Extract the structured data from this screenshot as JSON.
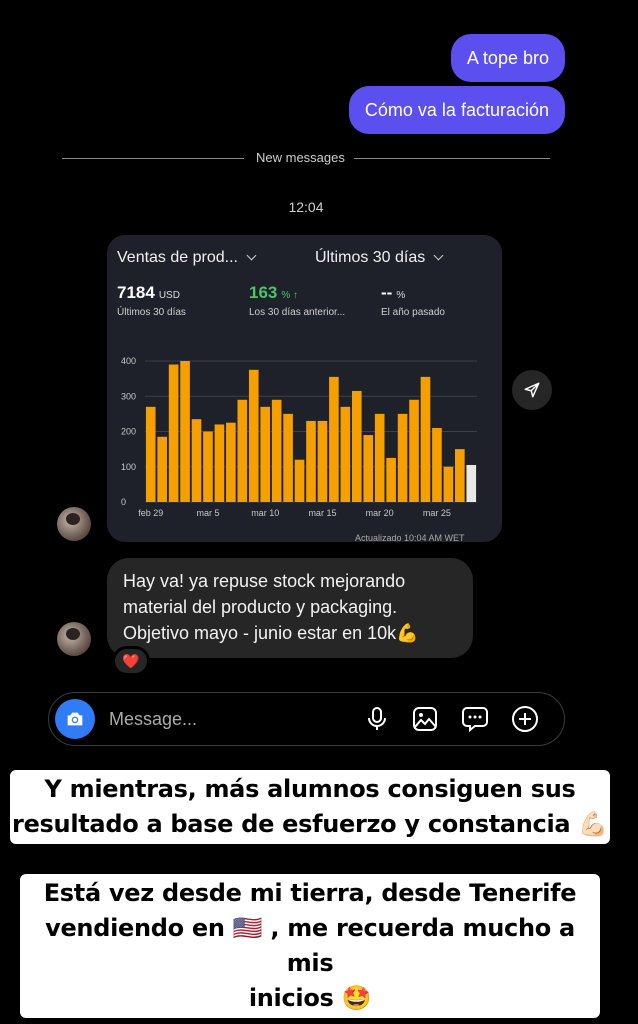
{
  "conversation": {
    "outgoing": [
      "A tope bro",
      "Cómo va la facturación"
    ],
    "divider_label": "New messages",
    "timestamp": "12:04",
    "incoming_text_lines": [
      "Hay va! ya repuse stock mejorando",
      "material del producto y packaging.",
      "Objetivo mayo - junio estar en 10k💪"
    ],
    "reaction": "❤️"
  },
  "card": {
    "dropdown_left": "Ventas de prod...",
    "dropdown_right": "Últimos 30 días",
    "stats": [
      {
        "value": "7184",
        "unit": "USD",
        "sub": "Últimos 30 días"
      },
      {
        "value": "163",
        "unit": "% ↑",
        "sub": "Los 30 días anterior..."
      },
      {
        "value": "--",
        "unit": "%",
        "sub": "El año pasado"
      }
    ],
    "updated": "Actualizado 10:04 AM WET",
    "bar_color": "#f5a000",
    "last_bar_color": "#e8e8e8"
  },
  "chart_data": {
    "type": "bar",
    "ylim": [
      0,
      400
    ],
    "yticks": [
      0,
      100,
      200,
      300,
      400
    ],
    "x_tick_labels": [
      "feb 29",
      "mar 5",
      "mar 10",
      "mar 15",
      "mar 20",
      "mar 25"
    ],
    "x_tick_index": [
      0,
      5,
      10,
      15,
      20,
      25
    ],
    "values": [
      270,
      185,
      390,
      400,
      235,
      200,
      220,
      225,
      290,
      375,
      270,
      290,
      250,
      120,
      230,
      230,
      355,
      270,
      315,
      190,
      250,
      125,
      250,
      290,
      355,
      210,
      100,
      150,
      105
    ],
    "grid": true
  },
  "composer": {
    "placeholder": "Message..."
  },
  "captions": {
    "c1": [
      "Y mientras, más alumnos consiguen sus",
      "resultado a base de esfuerzo y constancia 💪🏻"
    ],
    "c2": [
      "Está vez desde mi tierra, desde Tenerife",
      "vendiendo en 🇺🇸 , me recuerda mucho a mis",
      "inicios 🤩"
    ]
  }
}
